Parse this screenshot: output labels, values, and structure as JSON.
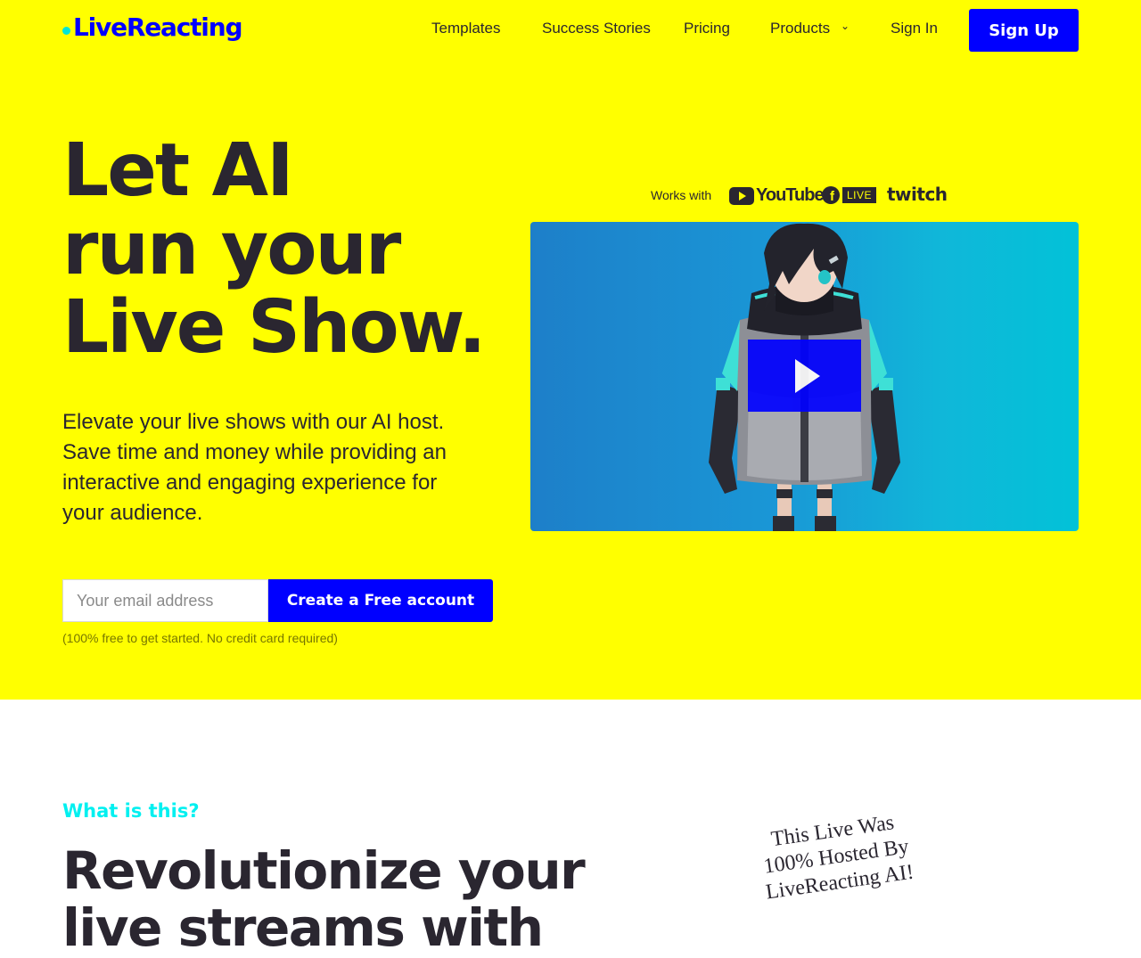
{
  "header": {
    "logo": "LiveReacting",
    "nav": {
      "templates": "Templates",
      "success_stories": "Success Stories",
      "pricing": "Pricing",
      "products": "Products",
      "sign_in": "Sign In",
      "sign_up": "Sign Up"
    }
  },
  "hero": {
    "headline": [
      "Let AI",
      "run your",
      "Live Show."
    ],
    "subtext": "Elevate your live shows with our AI host. Save time and money while providing an interactive and engaging experience for your audience.",
    "email_placeholder": "Your email address",
    "cta": "Create a Free account",
    "fineprint": "(100% free to get started. No credit card required)"
  },
  "works_with": {
    "label": "Works with",
    "platforms": {
      "youtube": "YouTube",
      "facebook_live": "LIVE",
      "twitch": "twitch"
    }
  },
  "video": {
    "play_icon": "play-icon"
  },
  "section": {
    "label": "What is this?",
    "title": "Revolutionize your live streams with",
    "badge": "This Live Was 100% Hosted By LiveReacting AI!"
  },
  "colors": {
    "hero_bg": "#ffff00",
    "brand_blue": "#0000ff",
    "accent_cyan": "#00f0f0",
    "text_dark": "#2a2630"
  }
}
